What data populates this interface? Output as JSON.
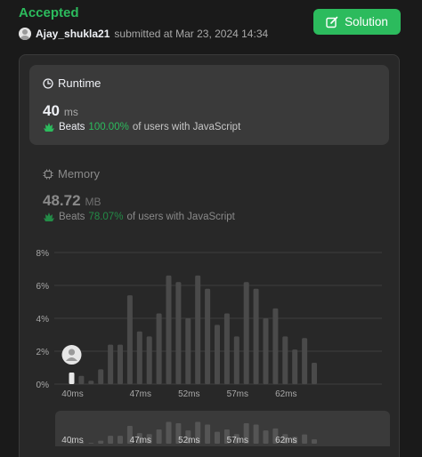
{
  "header": {
    "status": "Accepted",
    "username": "Ajay_shukla21",
    "submitted_text": "submitted at Mar 23, 2024 14:34",
    "solution_label": "Solution"
  },
  "runtime": {
    "title": "Runtime",
    "value": "40",
    "unit": "ms",
    "beats_label": "Beats",
    "beats_pct": "100.00%",
    "beats_suffix": "of users with JavaScript"
  },
  "memory": {
    "title": "Memory",
    "value": "48.72",
    "unit": "MB",
    "beats_label": "Beats",
    "beats_pct": "78.07%",
    "beats_suffix": "of users with JavaScript"
  },
  "colors": {
    "accent": "#2cbb5d",
    "bar": "#4a4a4a",
    "bar_highlight": "#e8e8e8"
  },
  "chart_data": {
    "type": "bar",
    "x": [
      40,
      41,
      42,
      43,
      44,
      45,
      46,
      47,
      48,
      49,
      50,
      51,
      52,
      53,
      54,
      55,
      56,
      57,
      58,
      59,
      60,
      61,
      62,
      63,
      64,
      65,
      66
    ],
    "values": [
      0.7,
      0.5,
      0.2,
      0.9,
      2.4,
      2.4,
      5.4,
      3.2,
      2.9,
      4.3,
      6.6,
      6.2,
      4.0,
      6.6,
      5.8,
      3.6,
      4.3,
      2.9,
      6.2,
      5.8,
      4.0,
      4.6,
      2.9,
      2.1,
      2.8,
      1.3,
      0
    ],
    "highlight_x": 40,
    "y_ticks": [
      "0%",
      "2%",
      "4%",
      "6%",
      "8%"
    ],
    "ylim": [
      0,
      8
    ],
    "x_tick_labels": [
      "40ms",
      "47ms",
      "52ms",
      "57ms",
      "62ms"
    ]
  }
}
